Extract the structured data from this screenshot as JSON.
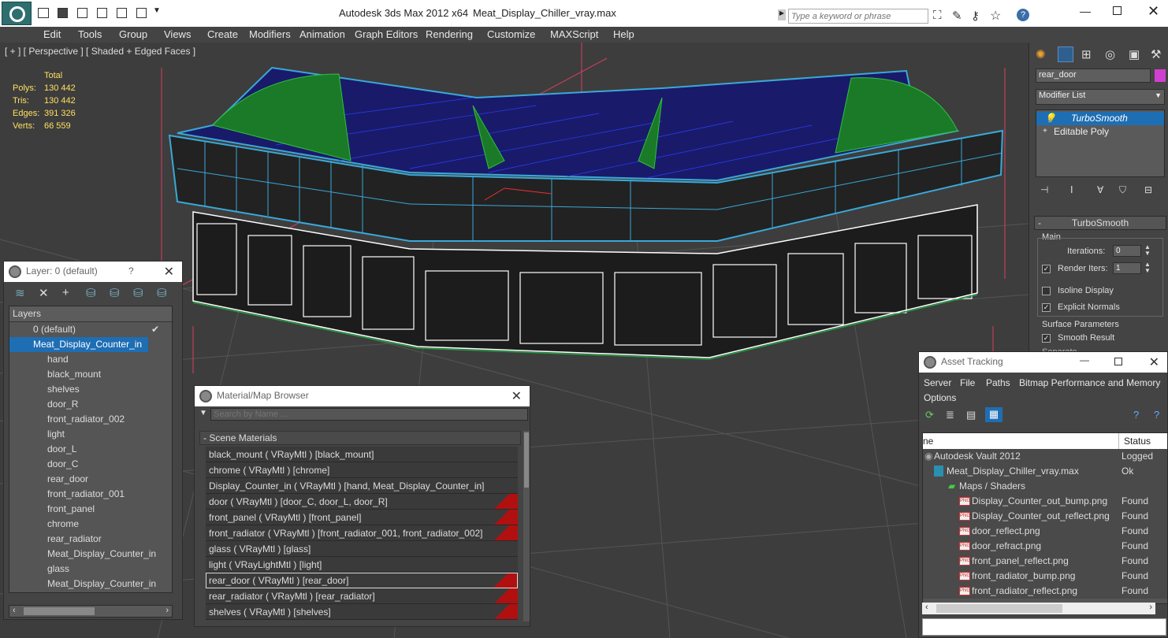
{
  "app": {
    "title": "Autodesk 3ds Max  2012 x64",
    "filename": "Meat_Display_Chiller_vray.max",
    "search_placeholder": "Type a keyword or phrase"
  },
  "menu": [
    "Edit",
    "Tools",
    "Group",
    "Views",
    "Create",
    "Modifiers",
    "Animation",
    "Graph Editors",
    "Rendering",
    "Customize",
    "MAXScript",
    "Help"
  ],
  "viewport": {
    "label": "[ + ] [ Perspective ] [ Shaded + Edged Faces ]",
    "stats": {
      "header": "Total",
      "rows": [
        {
          "k": "Polys:",
          "v": "130 442"
        },
        {
          "k": "Tris:",
          "v": "130 442"
        },
        {
          "k": "Edges:",
          "v": "391 326"
        },
        {
          "k": "Verts:",
          "v": "66 559"
        }
      ]
    }
  },
  "cmdpanel": {
    "object_name": "rear_door",
    "modifier_list": "Modifier List",
    "stack": [
      "TurboSmooth",
      "Editable Poly"
    ],
    "rollout_title": "TurboSmooth",
    "main_group": "Main",
    "iterations_label": "Iterations:",
    "iterations_value": "0",
    "render_iters_label": "Render Iters:",
    "render_iters_value": "1",
    "isoline": "Isoline Display",
    "explicit_normals": "Explicit Normals",
    "surface_group": "Surface Parameters",
    "smooth_result": "Smooth Result",
    "separate": "Separate"
  },
  "layer": {
    "title": "Layer: 0 (default)",
    "help": "?",
    "header": "Layers",
    "items": [
      "0 (default)",
      "Meat_Display_Counter_in",
      "hand",
      "black_mount",
      "shelves",
      "door_R",
      "front_radiator_002",
      "light",
      "door_L",
      "door_C",
      "rear_door",
      "front_radiator_001",
      "front_panel",
      "chrome",
      "rear_radiator",
      "Meat_Display_Counter_in",
      "glass",
      "Meat_Display_Counter_in"
    ]
  },
  "matbrowser": {
    "title": "Material/Map Browser",
    "search_placeholder": "Search by Name ...",
    "group": "Scene Materials",
    "items": [
      "black_mount  ( VRayMtl ) [black_mount]",
      "chrome  ( VRayMtl ) [chrome]",
      "Display_Counter_in  ( VRayMtl ) [hand, Meat_Display_Counter_in]",
      "door  ( VRayMtl ) [door_C, door_L, door_R]",
      "front_panel  ( VRayMtl ) [front_panel]",
      "front_radiator  ( VRayMtl ) [front_radiator_001, front_radiator_002]",
      "glass  ( VRayMtl ) [glass]",
      "light  ( VRayLightMtl ) [light]",
      "rear_door  ( VRayMtl ) [rear_door]",
      "rear_radiator  ( VRayMtl ) [rear_radiator]",
      "shelves  ( VRayMtl ) [shelves]"
    ]
  },
  "asset": {
    "title": "Asset Tracking",
    "menu1": [
      "Server",
      "File",
      "Paths",
      "Bitmap Performance and Memory"
    ],
    "menu2": "Options",
    "col_name": "ne",
    "col_status": "Status",
    "rows": [
      {
        "n": "Autodesk Vault 2012",
        "s": "Logged"
      },
      {
        "n": "Meat_Display_Chiller_vray.max",
        "s": "Ok"
      },
      {
        "n": "Maps / Shaders",
        "s": ""
      },
      {
        "n": "Display_Counter_out_bump.png",
        "s": "Found"
      },
      {
        "n": "Display_Counter_out_reflect.png",
        "s": "Found"
      },
      {
        "n": "door_reflect.png",
        "s": "Found"
      },
      {
        "n": "door_refract.png",
        "s": "Found"
      },
      {
        "n": "front_panel_reflect.png",
        "s": "Found"
      },
      {
        "n": "front_radiator_bump.png",
        "s": "Found"
      },
      {
        "n": "front_radiator_reflect.png",
        "s": "Found"
      }
    ]
  },
  "colors": {
    "accent": "#1e6eb4",
    "wire_blue": "#3aa8d8",
    "wire_green": "#1fa030",
    "selected_row": "#1e6eb4"
  }
}
